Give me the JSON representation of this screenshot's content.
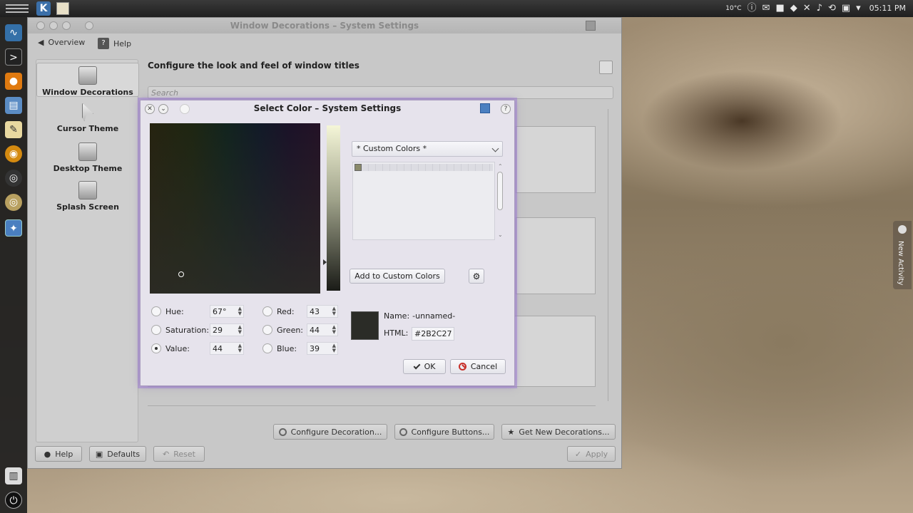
{
  "top_panel": {
    "icons": [
      "kmenu-icon",
      "kde-logo",
      "app-icon"
    ],
    "kde_glyph": "K",
    "temperature": "10°C",
    "clock": "05:11 PM"
  },
  "main_window": {
    "title": "Window Decorations – System Settings",
    "toolbar": {
      "overview": "Overview",
      "help": "Help"
    },
    "sidebar": [
      "Window Decorations",
      "Cursor Theme",
      "Desktop Theme",
      "Splash Screen"
    ],
    "header": "Configure the look and feel of window titles",
    "search_placeholder": "Search",
    "configure_decoration": "Configure Decoration...",
    "configure_buttons": "Configure Buttons...",
    "get_new": "Get New Decorations...",
    "bottom": {
      "help": "Help",
      "defaults": "Defaults",
      "reset": "Reset",
      "apply": "Apply"
    }
  },
  "dialog": {
    "title": "Select Color – System Settings",
    "collection": "* Custom Colors *",
    "add_custom": "Add to Custom Colors",
    "fields": {
      "hue_label": "Hue:",
      "hue": "67°",
      "saturation_label": "Saturation:",
      "saturation": "29",
      "value_label": "Value:",
      "value": "44",
      "red_label": "Red:",
      "red": "43",
      "green_label": "Green:",
      "green": "44",
      "blue_label": "Blue:",
      "blue": "39"
    },
    "name_label": "Name:",
    "name_value": "-unnamed-",
    "html_label": "HTML:",
    "html_value": "#2B2C27",
    "ok": "OK",
    "cancel": "Cancel"
  },
  "new_activity": "New Activity",
  "colors": {
    "selected_color": "#2B2C27",
    "dialog_glow": "#a082d2"
  }
}
